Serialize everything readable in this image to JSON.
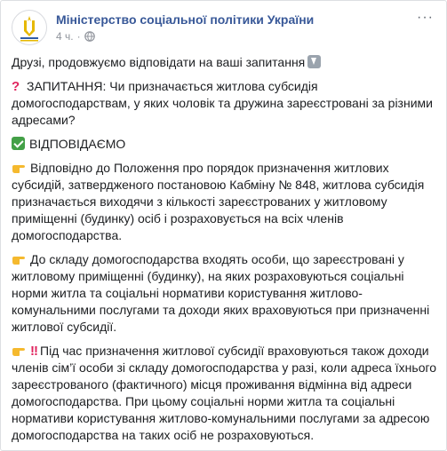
{
  "header": {
    "page_name": "Міністерство соціальної політики України",
    "time": "4 ч.",
    "separator": "·",
    "more": "···"
  },
  "icons": {
    "avatar": "ministry-emblem-icon",
    "privacy": "globe-icon",
    "intro": "down-arrow-emoji",
    "question": "red-question-mark-emoji",
    "answer": "check-mark-emoji",
    "pointer": "backhand-index-pointing-right-emoji",
    "warning": "double-exclamation-emoji"
  },
  "post": {
    "intro": "Друзі, продовжуємо відповідати на ваші запитання",
    "question": "ЗАПИТАННЯ: Чи призначається житлова субсидія домогосподарствам, у яких чоловік та дружина зареєстровані за різними адресами?",
    "answer_heading": "ВІДПОВІДАЄМО",
    "point1": "Відповідно до Положення про порядок призначення житлових субсидій, затвердженого постановою Кабміну № 848, житлова субсидія призначається виходячи з кількості зареєстрованих у житловому приміщенні (будинку) осіб і розраховується на всіх членів домогосподарства.",
    "point2": "До складу домогосподарства входять особи, що зареєстровані у житловому приміщенні (будинку), на яких розраховуються соціальні норми житла та соціальні нормативи користування житлово-комунальними послугами та доходи яких враховуються при призначенні житлової субсидії.",
    "point3": "Під час призначення житлової субсидії враховуються також доходи членів сім’ї особи зі складу домогосподарства у разі, коли адреса їхнього зареєстрованого (фактичного) місця проживання відмінна від адреси домогосподарства. При цьому соціальні норми житла та соціальні нормативи користування житлово-комунальними послугами за адресою домогосподарства на таких осіб не розраховуються."
  },
  "colors": {
    "page_name": "#385898",
    "meta": "#90949c",
    "text": "#1c1e21"
  }
}
